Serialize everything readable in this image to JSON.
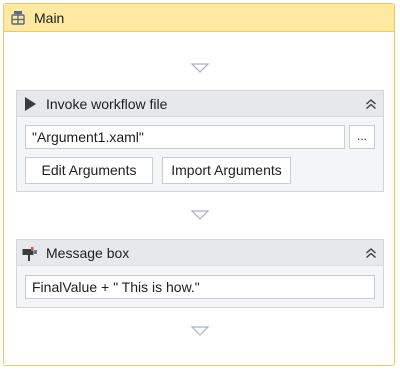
{
  "sequence": {
    "title": "Main",
    "icon": "sequence-icon"
  },
  "invoke_workflow": {
    "title": "Invoke workflow file",
    "icon": "play-triangle-icon",
    "file_value": "\"Argument1.xaml\"",
    "browse_label": "...",
    "edit_arguments_label": "Edit Arguments",
    "import_arguments_label": "Import Arguments",
    "collapse_icon": "double-chevron-up-icon"
  },
  "message_box": {
    "title": "Message box",
    "icon": "message-box-icon",
    "text_value": "FinalValue + \" This is how.\"",
    "collapse_icon": "double-chevron-up-icon"
  },
  "colors": {
    "sequence_border": "#f2c75c",
    "sequence_header_bg": "#fdeaa0",
    "activity_bg": "#f4f5f7",
    "activity_header_bg": "#e6e8eb",
    "drop_arrow": "#a9b3bf"
  }
}
